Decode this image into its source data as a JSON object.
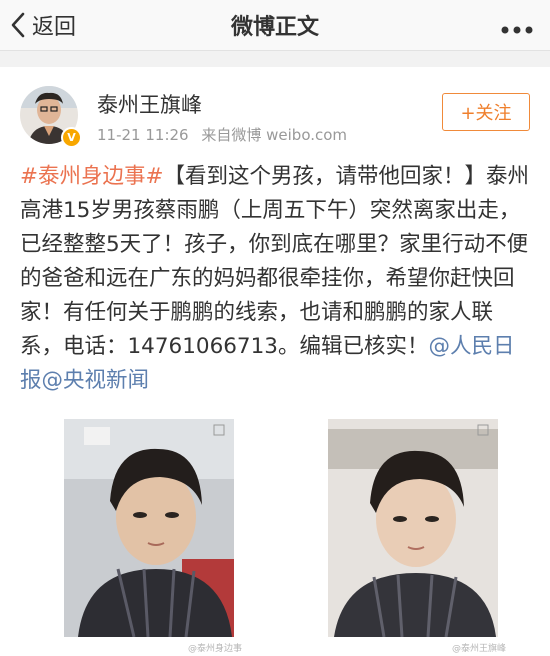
{
  "navbar": {
    "back_label": "返回",
    "title": "微博正文",
    "more_icon": "more-dots-icon"
  },
  "post": {
    "author": {
      "name": "泰州王旗峰",
      "verified_badge": "V",
      "avatar": "avatar-photo"
    },
    "meta": {
      "time": "11-21 11:26",
      "source": "来自微博 weibo.com"
    },
    "follow_label": "+关注",
    "text": {
      "hashtag": "#泰州身边事#",
      "body": "【看到这个男孩，请带他回家！】泰州高港15岁男孩蔡雨鹏（上周五下午）突然离家出走，已经整整5天了！孩子，你到底在哪里？家里行动不便的爸爸和远在广东的妈妈都很牵挂你，希望你赶快回家！有任何关于鹏鹏的线索，也请和鹏鹏的家人联系，电话：14761066713。编辑已核实！",
      "mention1": "@人民日报",
      "mention2": "@央视新闻"
    },
    "images": [
      {
        "name": "missing-boy-photo-1"
      },
      {
        "name": "missing-boy-photo-2"
      }
    ],
    "watermarks": [
      "@泰州身边事",
      "@泰州王旗峰"
    ]
  },
  "colors": {
    "link": "#eb7350",
    "mention": "#5d7fae",
    "follow": "#ef7f2c",
    "badge": "#f8a700"
  }
}
